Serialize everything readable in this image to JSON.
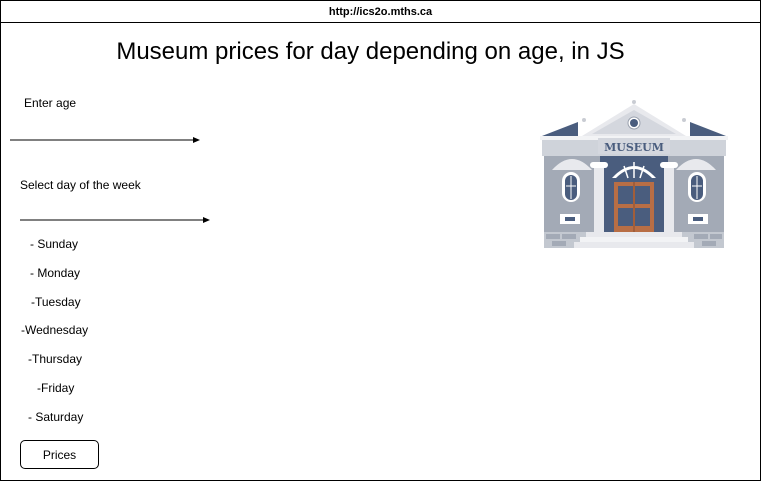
{
  "browser": {
    "url": "http://ics2o.mths.ca"
  },
  "page": {
    "title": "Museum prices for day depending on age, in JS"
  },
  "form": {
    "age_label": "Enter age",
    "day_label": "Select day of the week",
    "days": [
      "- Sunday",
      "- Monday",
      "-Tuesday",
      "-Wednesday",
      "-Thursday",
      "-Friday",
      "- Saturday"
    ],
    "submit_label": "Prices"
  },
  "illustration": {
    "sign_text": "MUSEUM",
    "icon": "museum-building-icon"
  }
}
